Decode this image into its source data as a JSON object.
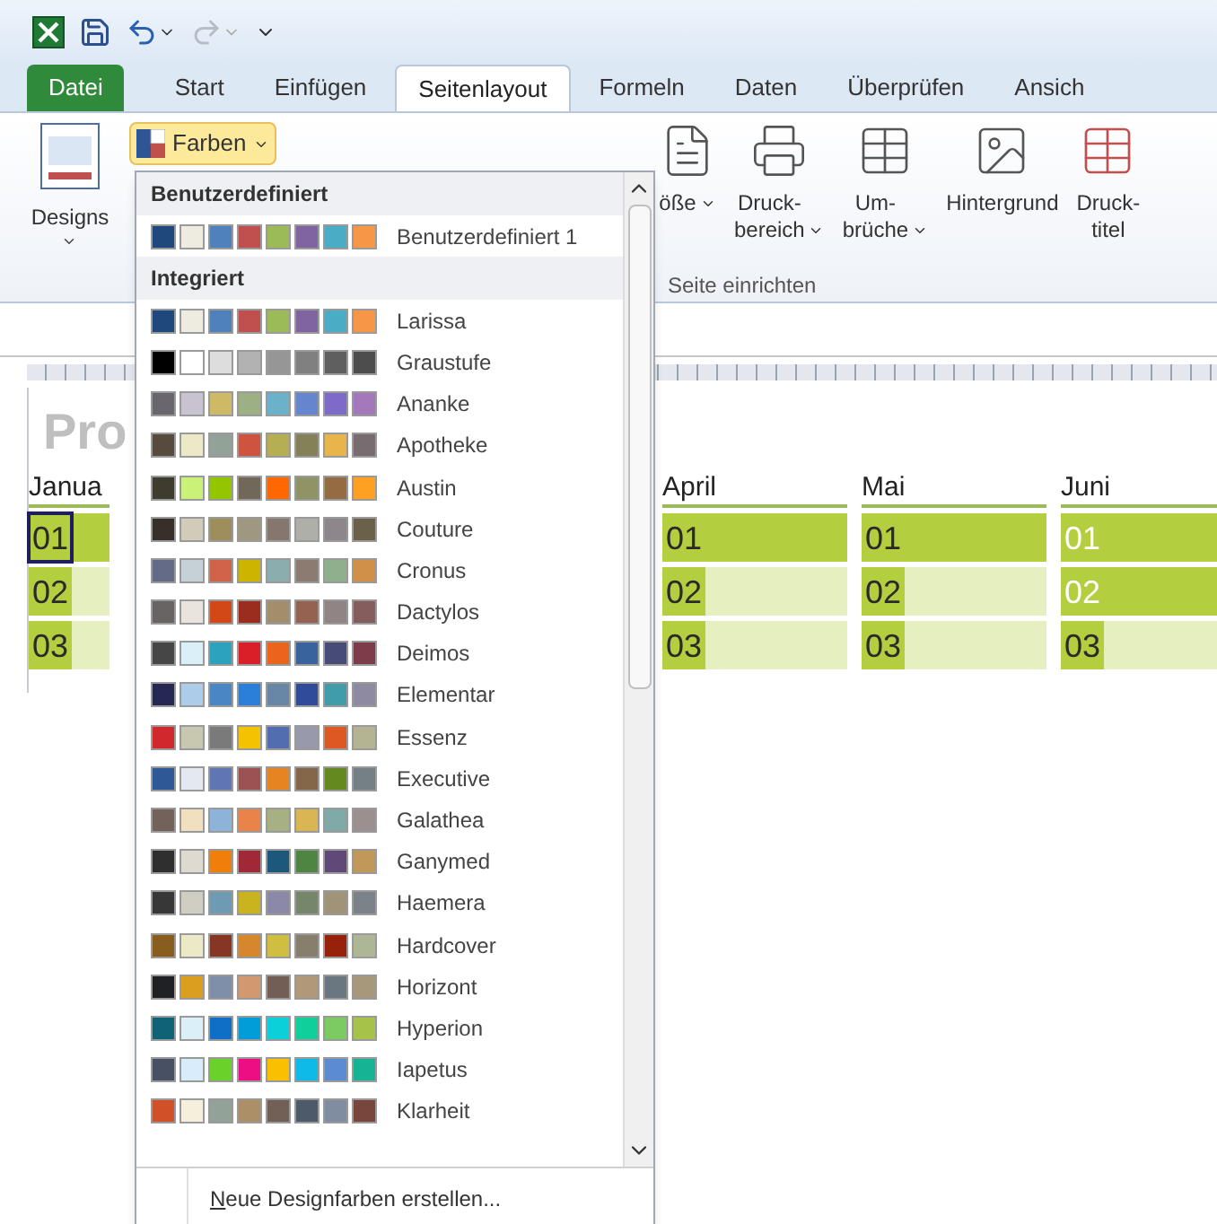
{
  "tabs": [
    {
      "label": "Datei",
      "kind": "file",
      "selected": false
    },
    {
      "label": "Start",
      "kind": "tab",
      "selected": false
    },
    {
      "label": "Einfügen",
      "kind": "tab",
      "selected": false
    },
    {
      "label": "Seitenlayout",
      "kind": "tab",
      "selected": true
    },
    {
      "label": "Formeln",
      "kind": "tab",
      "selected": false
    },
    {
      "label": "Daten",
      "kind": "tab",
      "selected": false
    },
    {
      "label": "Überprüfen",
      "kind": "tab",
      "selected": false
    },
    {
      "label": "Ansich",
      "kind": "tab",
      "selected": false
    }
  ],
  "ribbon": {
    "designs": {
      "label": "Designs"
    },
    "colors_button": {
      "label": "Farben",
      "expanded": true
    },
    "buttons": [
      {
        "label": "öße",
        "kind": "size",
        "dropdown": true
      },
      {
        "label": "Druck-\nbereich",
        "kind": "print",
        "dropdown": true
      },
      {
        "label": "Um-\nbrüche",
        "kind": "breaks",
        "dropdown": true
      },
      {
        "label": "Hintergrund",
        "kind": "background",
        "dropdown": false
      },
      {
        "label": "Druck-\ntitel",
        "kind": "titles",
        "dropdown": false
      }
    ],
    "group_label": "Seite einrichten"
  },
  "colors_menu": {
    "sections": [
      {
        "title": "Benutzerdefiniert",
        "themes": [
          {
            "name": "Benutzerdefiniert 1",
            "swatches": [
              {
                "color": "#1f497d"
              },
              {
                "color": "#eeece1"
              },
              {
                "color": "#4f81bd"
              },
              {
                "color": "#c0504d"
              },
              {
                "color": "#9bbb59"
              },
              {
                "color": "#8064a2"
              },
              {
                "color": "#4bacc6"
              },
              {
                "color": "#f79646"
              }
            ]
          }
        ]
      },
      {
        "title": "Integriert",
        "themes": [
          {
            "name": "Larissa",
            "swatches": [
              {
                "color": "#1f497d"
              },
              {
                "color": "#eeece1"
              },
              {
                "color": "#4f81bd"
              },
              {
                "color": "#c0504d"
              },
              {
                "color": "#9bbb59"
              },
              {
                "color": "#8064a2"
              },
              {
                "color": "#4bacc6"
              },
              {
                "color": "#f79646"
              }
            ]
          },
          {
            "name": "Graustufe",
            "swatches": [
              {
                "color": "#000000"
              },
              {
                "color": "#ffffff"
              },
              {
                "color": "#dddddd"
              },
              {
                "color": "#b2b2b2"
              },
              {
                "color": "#969696"
              },
              {
                "color": "#808080"
              },
              {
                "color": "#5f5f5f"
              },
              {
                "color": "#4d4d4d"
              }
            ]
          },
          {
            "name": "Ananke",
            "swatches": [
              {
                "color": "#69676d"
              },
              {
                "color": "#c9c2d1"
              },
              {
                "color": "#ceb966"
              },
              {
                "color": "#9cb084"
              },
              {
                "color": "#6bb1c9"
              },
              {
                "color": "#6585cf"
              },
              {
                "color": "#7e6bc9"
              },
              {
                "color": "#a379bb"
              }
            ]
          },
          {
            "name": "Apotheke",
            "swatches": [
              {
                "color": "#564b3c"
              },
              {
                "color": "#ece9c6"
              },
              {
                "color": "#93a299"
              },
              {
                "color": "#cf543f"
              },
              {
                "color": "#b5ae53"
              },
              {
                "color": "#848058"
              },
              {
                "color": "#e8b54d"
              },
              {
                "color": "#786c71"
              }
            ]
          },
          {
            "name": "Austin",
            "swatches": [
              {
                "color": "#3e3d2d"
              },
              {
                "color": "#caf278"
              },
              {
                "color": "#94c600"
              },
              {
                "color": "#71685a"
              },
              {
                "color": "#ff6700"
              },
              {
                "color": "#909465"
              },
              {
                "color": "#956b43"
              },
              {
                "color": "#fea022"
              }
            ]
          },
          {
            "name": "Couture",
            "swatches": [
              {
                "color": "#37302a"
              },
              {
                "color": "#d0ccb9"
              },
              {
                "color": "#9e8e5c"
              },
              {
                "color": "#a09781"
              },
              {
                "color": "#85776d"
              },
              {
                "color": "#aeafa9"
              },
              {
                "color": "#8d878b"
              },
              {
                "color": "#6b6149"
              }
            ]
          },
          {
            "name": "Cronus",
            "swatches": [
              {
                "color": "#646b86"
              },
              {
                "color": "#c5d1d7"
              },
              {
                "color": "#d16349"
              },
              {
                "color": "#ccb400"
              },
              {
                "color": "#8cadae"
              },
              {
                "color": "#8c7b70"
              },
              {
                "color": "#8fb08c"
              },
              {
                "color": "#d19049"
              }
            ]
          },
          {
            "name": "Dactylos",
            "swatches": [
              {
                "color": "#696464"
              },
              {
                "color": "#e9e5dc"
              },
              {
                "color": "#d34817"
              },
              {
                "color": "#9b2d1f"
              },
              {
                "color": "#a28e6a"
              },
              {
                "color": "#956251"
              },
              {
                "color": "#918485"
              },
              {
                "color": "#855d5d"
              }
            ]
          },
          {
            "name": "Deimos",
            "swatches": [
              {
                "color": "#464646"
              },
              {
                "color": "#dbeff9"
              },
              {
                "color": "#2da2bf"
              },
              {
                "color": "#da1f28"
              },
              {
                "color": "#eb641b"
              },
              {
                "color": "#39639d"
              },
              {
                "color": "#474b78"
              },
              {
                "color": "#7d3c4a"
              }
            ]
          },
          {
            "name": "Elementar",
            "swatches": [
              {
                "color": "#242852"
              },
              {
                "color": "#acccea"
              },
              {
                "color": "#4a86c4"
              },
              {
                "color": "#2b7fd8"
              },
              {
                "color": "#6886a6"
              },
              {
                "color": "#2f4b9a"
              },
              {
                "color": "#409ca8"
              },
              {
                "color": "#8e8aa1"
              }
            ]
          },
          {
            "name": "Essenz",
            "swatches": [
              {
                "color": "#d1282e"
              },
              {
                "color": "#c8c8b1"
              },
              {
                "color": "#7a7a7a"
              },
              {
                "color": "#f5c201"
              },
              {
                "color": "#526db0"
              },
              {
                "color": "#989aac"
              },
              {
                "color": "#dc5924"
              },
              {
                "color": "#b4b392"
              }
            ]
          },
          {
            "name": "Executive",
            "swatches": [
              {
                "color": "#2f5897"
              },
              {
                "color": "#e4e9ef"
              },
              {
                "color": "#6076b4"
              },
              {
                "color": "#9c5252"
              },
              {
                "color": "#e68422"
              },
              {
                "color": "#846648"
              },
              {
                "color": "#63891f"
              },
              {
                "color": "#758085"
              }
            ]
          },
          {
            "name": "Galathea",
            "swatches": [
              {
                "color": "#72625a"
              },
              {
                "color": "#f0e0c0"
              },
              {
                "color": "#8db3d8"
              },
              {
                "color": "#e8834a"
              },
              {
                "color": "#a6b083"
              },
              {
                "color": "#d9b653"
              },
              {
                "color": "#7faaa8"
              },
              {
                "color": "#9b8f8f"
              }
            ]
          },
          {
            "name": "Ganymed",
            "swatches": [
              {
                "color": "#2f2f2f"
              },
              {
                "color": "#dedacf"
              },
              {
                "color": "#f07f09"
              },
              {
                "color": "#9f2936"
              },
              {
                "color": "#1b587c"
              },
              {
                "color": "#4e8542"
              },
              {
                "color": "#604878"
              },
              {
                "color": "#c19859"
              }
            ]
          },
          {
            "name": "Haemera",
            "swatches": [
              {
                "color": "#373737"
              },
              {
                "color": "#d0cec3"
              },
              {
                "color": "#6e9bb3"
              },
              {
                "color": "#c9b420"
              },
              {
                "color": "#8b88a8"
              },
              {
                "color": "#76866a"
              },
              {
                "color": "#a09378"
              },
              {
                "color": "#7b8289"
              }
            ]
          },
          {
            "name": "Hardcover",
            "swatches": [
              {
                "color": "#895d1d"
              },
              {
                "color": "#ece9c6"
              },
              {
                "color": "#873624"
              },
              {
                "color": "#d6862d"
              },
              {
                "color": "#d0be40"
              },
              {
                "color": "#877f6c"
              },
              {
                "color": "#972109"
              },
              {
                "color": "#aeb795"
              }
            ]
          },
          {
            "name": "Horizont",
            "swatches": [
              {
                "color": "#1f2123"
              },
              {
                "color": "#dc9e1f"
              },
              {
                "color": "#7f8fa9"
              },
              {
                "color": "#d29870"
              },
              {
                "color": "#725e55"
              },
              {
                "color": "#b09879"
              },
              {
                "color": "#6b7780"
              },
              {
                "color": "#a7977b"
              }
            ]
          },
          {
            "name": "Hyperion",
            "swatches": [
              {
                "color": "#106377"
              },
              {
                "color": "#daeff7"
              },
              {
                "color": "#0f6fc6"
              },
              {
                "color": "#009dd9"
              },
              {
                "color": "#0bd0d9"
              },
              {
                "color": "#10cf9b"
              },
              {
                "color": "#7cca62"
              },
              {
                "color": "#a5c249"
              }
            ]
          },
          {
            "name": "Iapetus",
            "swatches": [
              {
                "color": "#485063"
              },
              {
                "color": "#d9ecfa"
              },
              {
                "color": "#6ad12a"
              },
              {
                "color": "#ed0e84"
              },
              {
                "color": "#f9bf00"
              },
              {
                "color": "#0ebbe8"
              },
              {
                "color": "#5b8bd1"
              },
              {
                "color": "#17b395"
              }
            ]
          },
          {
            "name": "Klarheit",
            "swatches": [
              {
                "color": "#d05028"
              },
              {
                "color": "#f5f0dc"
              },
              {
                "color": "#93a299"
              },
              {
                "color": "#ad8f67"
              },
              {
                "color": "#726056"
              },
              {
                "color": "#4c5a6a"
              },
              {
                "color": "#808da0"
              },
              {
                "color": "#79463d"
              }
            ]
          }
        ]
      }
    ],
    "footer": "Neue Designfarben erstellen..."
  },
  "sheet": {
    "title": "Pro",
    "months": [
      {
        "name": "Janua",
        "days": [
          {
            "day": "01",
            "kind": "holiday",
            "selected": true
          },
          {
            "day": "02",
            "kind": "workday",
            "selected": false
          },
          {
            "day": "03",
            "kind": "workday",
            "selected": false
          }
        ]
      },
      {
        "name": "April",
        "days": [
          {
            "day": "01",
            "kind": "holiday",
            "selected": false
          },
          {
            "day": "02",
            "kind": "workday",
            "selected": false
          },
          {
            "day": "03",
            "kind": "workday",
            "selected": false
          }
        ]
      },
      {
        "name": "Mai",
        "days": [
          {
            "day": "01",
            "kind": "holiday",
            "selected": false
          },
          {
            "day": "02",
            "kind": "workday",
            "selected": false
          },
          {
            "day": "03",
            "kind": "workday",
            "selected": false
          }
        ]
      },
      {
        "name": "Juni",
        "days": [
          {
            "day": "01",
            "kind": "weekend",
            "selected": false
          },
          {
            "day": "02",
            "kind": "weekend",
            "selected": false
          },
          {
            "day": "03",
            "kind": "workday",
            "selected": false
          }
        ]
      }
    ]
  }
}
